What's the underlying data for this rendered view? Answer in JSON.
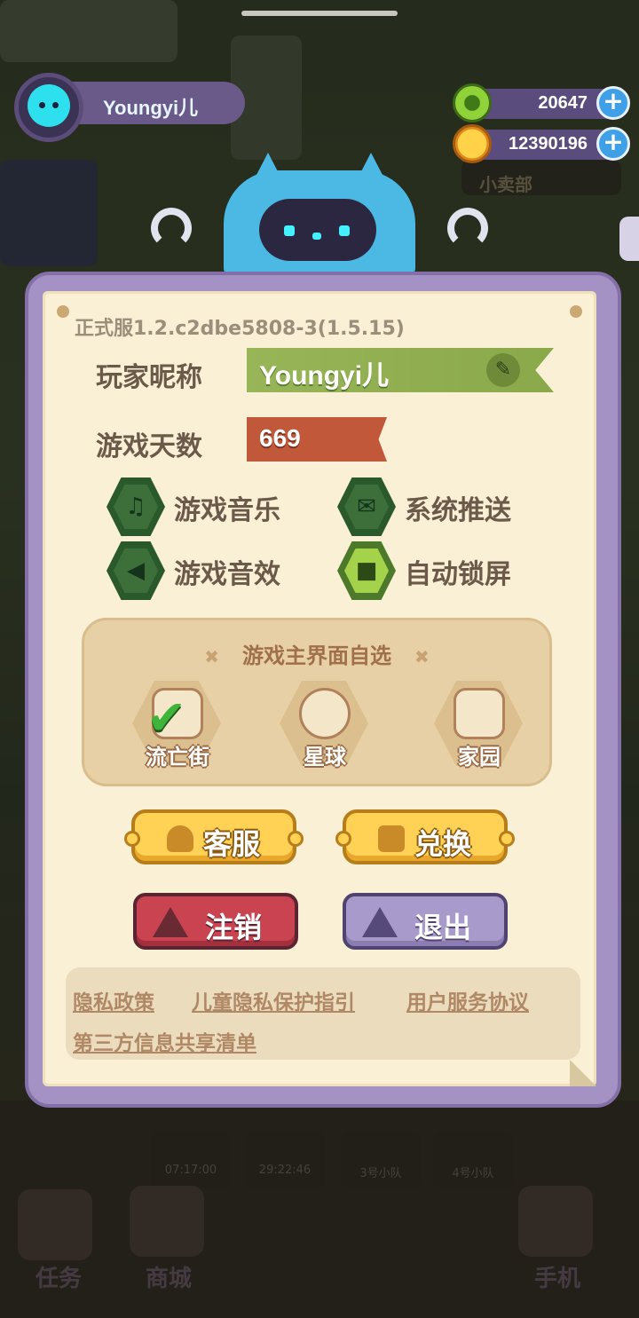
{
  "profile": {
    "username": "Youngyi儿"
  },
  "currency": [
    {
      "name": "green-ring-currency",
      "value": "20647",
      "color": "#7cc23a"
    },
    {
      "name": "planet-coin-currency",
      "value": "12390196",
      "color": "#f3b02a"
    }
  ],
  "settings": {
    "version": "正式服1.2.c2dbe5808-3(1.5.15)",
    "nickname_label": "玩家昵称",
    "nickname_value": "Youngyi儿",
    "days_label": "游戏天数",
    "days_value": "669",
    "toggles": [
      {
        "label": "游戏音乐",
        "icon": "music-note-icon",
        "on": false
      },
      {
        "label": "系统推送",
        "icon": "envelope-icon",
        "on": false
      },
      {
        "label": "游戏音效",
        "icon": "speaker-icon",
        "on": false
      },
      {
        "label": "自动锁屏",
        "icon": "lock-icon",
        "on": true
      }
    ],
    "home_selector": {
      "title": "游戏主界面自选",
      "options": [
        {
          "name": "流亡街",
          "selected": true
        },
        {
          "name": "星球",
          "selected": false
        },
        {
          "name": "家园",
          "selected": false
        }
      ]
    },
    "buttons": {
      "customer_service": "客服",
      "redeem": "兑换",
      "cancel_account": "注销",
      "logout": "退出"
    },
    "links": {
      "privacy_policy": "隐私政策",
      "child_privacy": "儿童隐私保护指引",
      "user_agreement": "用户服务协议",
      "third_party": "第三方信息共享清单"
    }
  },
  "background": {
    "timers": [
      "07:17:00",
      "29:22:46"
    ],
    "teams": [
      "3号小队",
      "4号小队"
    ],
    "nav": [
      "任务",
      "商城",
      "手机"
    ],
    "shop_sign": "小卖部"
  }
}
